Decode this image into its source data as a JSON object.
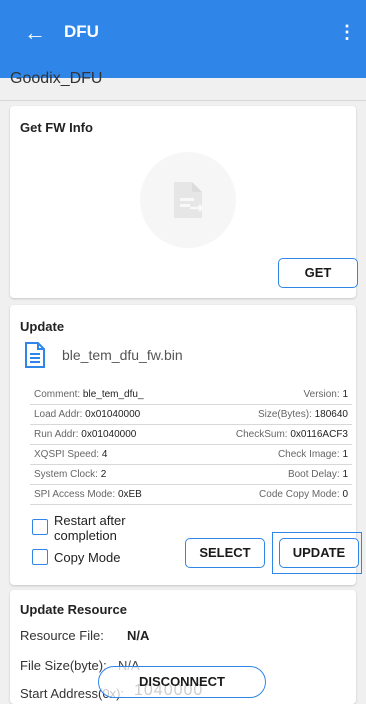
{
  "appbar": {
    "back_icon": "back-arrow-icon",
    "title": "DFU",
    "menu_icon": "more-vert-icon"
  },
  "device_name": "Goodix_DFU",
  "fw_info": {
    "title": "Get FW Info",
    "icon": "file-icon",
    "get_label": "GET"
  },
  "update": {
    "title": "Update",
    "file_icon": "document-icon",
    "file_name": "ble_tem_dfu_fw.bin",
    "rows": [
      {
        "left_label": "Comment:",
        "left_value": "ble_tem_dfu_",
        "right_label": "Version:",
        "right_value": "1"
      },
      {
        "left_label": "Load Addr:",
        "left_value": "0x01040000",
        "right_label": "Size(Bytes):",
        "right_value": "180640"
      },
      {
        "left_label": "Run Addr:",
        "left_value": "0x01040000",
        "right_label": "CheckSum:",
        "right_value": "0x0116ACF3"
      },
      {
        "left_label": "XQSPI Speed:",
        "left_value": "4",
        "right_label": "Check Image:",
        "right_value": "1"
      },
      {
        "left_label": "System Clock:",
        "left_value": "2",
        "right_label": "Boot Delay:",
        "right_value": "1"
      },
      {
        "left_label": "SPI Access Mode:",
        "left_value": "0xEB",
        "right_label": "Code Copy Mode:",
        "right_value": "0"
      }
    ],
    "restart_label_1": "Restart after",
    "restart_label_2": "completion",
    "copy_mode_label": "Copy Mode",
    "select_label": "SELECT",
    "update_label": "UPDATE"
  },
  "resource": {
    "title": "Update Resource",
    "file_label": "Resource File:",
    "file_value": "N/A",
    "size_label": "File Size(byte):",
    "size_value": "N/A",
    "start_label": "Start Address(0x):",
    "start_value": "1040000"
  },
  "disconnect_label": "DISCONNECT",
  "colors": {
    "accent": "#2f86e8",
    "background": "#f0f0f0"
  }
}
